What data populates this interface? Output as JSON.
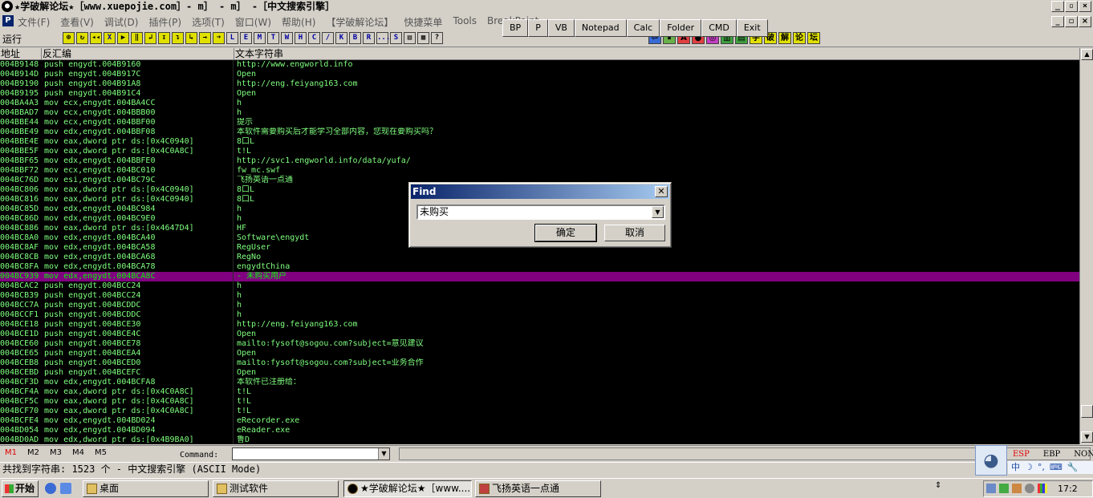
{
  "window": {
    "title": "★学破解论坛★［www.xuepojie.com］- m］ - m］ -［中文搜索引擎］",
    "app_icon": "ollydbg-icon",
    "controls": [
      "_",
      "▫",
      "×"
    ]
  },
  "menu": {
    "items": [
      "文件(F)",
      "查看(V)",
      "调试(D)",
      "插件(P)",
      "选项(T)",
      "窗口(W)",
      "帮助(H)",
      "【学破解论坛】",
      "快捷菜单",
      "Tools",
      "BreakPoint"
    ]
  },
  "plugin_toolbar": {
    "buttons": [
      "BP",
      "P",
      "VB",
      "Notepad",
      "Calc",
      "Folder",
      "CMD",
      "Exit"
    ]
  },
  "toolbar": {
    "run_status": "运行",
    "icons": [
      "⊕",
      "↻",
      "◂◂",
      "X",
      "▶",
      "‖",
      "↲",
      "↧",
      "↴",
      "↳",
      "→",
      "➜",
      "L",
      "E",
      "M",
      "T",
      "W",
      "H",
      "C",
      "/",
      "K",
      "B",
      "R",
      "...",
      "S",
      "▤",
      "▦",
      "?"
    ],
    "right_icons": [
      "⇦",
      "⏸",
      "A",
      "●",
      "◎",
      "▥",
      "▤",
      "字",
      "破",
      "解",
      "论",
      "坛"
    ]
  },
  "columns": {
    "address": "地址",
    "disasm": "反汇编",
    "text": "文本字符串"
  },
  "rows": [
    {
      "addr": "004B9148",
      "asm": "push engydt.004B9160",
      "text": "http://www.engworld.info"
    },
    {
      "addr": "004B914D",
      "asm": "push engydt.004B917C",
      "text": "Open"
    },
    {
      "addr": "004B9190",
      "asm": "push engydt.004B91A8",
      "text": "http://eng.feiyang163.com"
    },
    {
      "addr": "004B9195",
      "asm": "push engydt.004B91C4",
      "text": "Open"
    },
    {
      "addr": "004BA4A3",
      "asm": "mov ecx,engydt.004BA4CC",
      "text": "h"
    },
    {
      "addr": "004BBAD7",
      "asm": "mov ecx,engydt.004BBB00",
      "text": "h"
    },
    {
      "addr": "004BBE44",
      "asm": "mov ecx,engydt.004BBF00",
      "text": "提示"
    },
    {
      "addr": "004BBE49",
      "asm": "mov edx,engydt.004BBF08",
      "text": "本软件需要购买后才能学习全部内容，您现在要购买吗？"
    },
    {
      "addr": "004BBE4E",
      "asm": "mov eax,dword ptr ds:[0x4C0940]",
      "text": "8口L"
    },
    {
      "addr": "004BBE5F",
      "asm": "mov eax,dword ptr ds:[0x4C0A8C]",
      "text": "t!L"
    },
    {
      "addr": "004BBF65",
      "asm": "mov edx,engydt.004BBFE0",
      "text": "http://svc1.engworld.info/data/yufa/"
    },
    {
      "addr": "004BBF72",
      "asm": "mov ecx,engydt.004BC010",
      "text": "fw_mc.swf"
    },
    {
      "addr": "004BC76D",
      "asm": "mov esi,engydt.004BC79C",
      "text": "飞扬英语一点通"
    },
    {
      "addr": "004BC806",
      "asm": "mov eax,dword ptr ds:[0x4C0940]",
      "text": "8口L"
    },
    {
      "addr": "004BC816",
      "asm": "mov eax,dword ptr ds:[0x4C0940]",
      "text": "8口L"
    },
    {
      "addr": "004BC85D",
      "asm": "mov edx,engydt.004BC984",
      "text": "h"
    },
    {
      "addr": "004BC86D",
      "asm": "mov edx,engydt.004BC9E0",
      "text": "h"
    },
    {
      "addr": "004BC886",
      "asm": "mov eax,dword ptr ds:[0x4647D4]",
      "text": " HF"
    },
    {
      "addr": "004BC8A0",
      "asm": "mov edx,engydt.004BCA40",
      "text": "Software\\engydt"
    },
    {
      "addr": "004BC8AF",
      "asm": "mov edx,engydt.004BCA58",
      "text": "RegUser"
    },
    {
      "addr": "004BC8CB",
      "asm": "mov edx,engydt.004BCA68",
      "text": "RegNo"
    },
    {
      "addr": "004BC8FA",
      "asm": "mov edx,engydt.004BCA78",
      "text": "engydtChina"
    },
    {
      "addr": "004BC939",
      "asm": "mov edx,engydt.004BCA8C",
      "text": " - 未购买用户",
      "selected": true
    },
    {
      "addr": "004BCAC2",
      "asm": "push engydt.004BCC24",
      "text": "h"
    },
    {
      "addr": "004BCB39",
      "asm": "push engydt.004BCC24",
      "text": "h"
    },
    {
      "addr": "004BCC7A",
      "asm": "push engydt.004BCDDC",
      "text": "h"
    },
    {
      "addr": "004BCCF1",
      "asm": "push engydt.004BCDDC",
      "text": "h"
    },
    {
      "addr": "004BCE18",
      "asm": "push engydt.004BCE30",
      "text": "http://eng.feiyang163.com"
    },
    {
      "addr": "004BCE1D",
      "asm": "push engydt.004BCE4C",
      "text": "Open"
    },
    {
      "addr": "004BCE60",
      "asm": "push engydt.004BCE78",
      "text": "mailto:fysoft@sogou.com?subject=意见建议"
    },
    {
      "addr": "004BCE65",
      "asm": "push engydt.004BCEA4",
      "text": "Open"
    },
    {
      "addr": "004BCEB8",
      "asm": "push engydt.004BCED0",
      "text": "mailto:fysoft@sogou.com?subject=业务合作"
    },
    {
      "addr": "004BCEBD",
      "asm": "push engydt.004BCEFC",
      "text": "Open"
    },
    {
      "addr": "004BCF3D",
      "asm": "mov edx,engydt.004BCFA8",
      "text": "本软件已注册给："
    },
    {
      "addr": "004BCF4A",
      "asm": "mov eax,dword ptr ds:[0x4C0A8C]",
      "text": "t!L"
    },
    {
      "addr": "004BCF5C",
      "asm": "mov eax,dword ptr ds:[0x4C0A8C]",
      "text": "t!L"
    },
    {
      "addr": "004BCF70",
      "asm": "mov eax,dword ptr ds:[0x4C0A8C]",
      "text": "t!L"
    },
    {
      "addr": "004BCFE4",
      "asm": "mov edx,engydt.004BD024",
      "text": "eRecorder.exe"
    },
    {
      "addr": "004BD054",
      "asm": "mov edx,engydt.004BD094",
      "text": "eReader.exe"
    },
    {
      "addr": "004BD0AD",
      "asm": "mov edx,dword ptr ds:[0x4B9BA0]",
      "text": "鲁D"
    }
  ],
  "bottom": {
    "mtabs": [
      "M1",
      "M2",
      "M3",
      "M4",
      "M5"
    ],
    "command_label": "Command:",
    "command_value": "",
    "registers": [
      "ESP",
      "EBP",
      "NONE"
    ]
  },
  "status": "共找到字符串: 1523 个  - 中文搜索引擎 (ASCII Mode)",
  "find_dialog": {
    "title": "Find",
    "value": "未购买",
    "ok": "确定",
    "cancel": "取消"
  },
  "ime": {
    "items": [
      "中",
      "☽",
      "°,",
      "⌨",
      "🔧"
    ]
  },
  "taskbar": {
    "start": "开始",
    "tasks": [
      {
        "label": "桌面",
        "icon": "folder-icon"
      },
      {
        "label": "测试软件",
        "icon": "folder-icon"
      },
      {
        "label": "★学破解论坛★［www....",
        "icon": "ollydbg-icon",
        "active": true
      },
      {
        "label": "飞扬英语一点通",
        "icon": "app-icon"
      }
    ],
    "clock": "17:2"
  }
}
